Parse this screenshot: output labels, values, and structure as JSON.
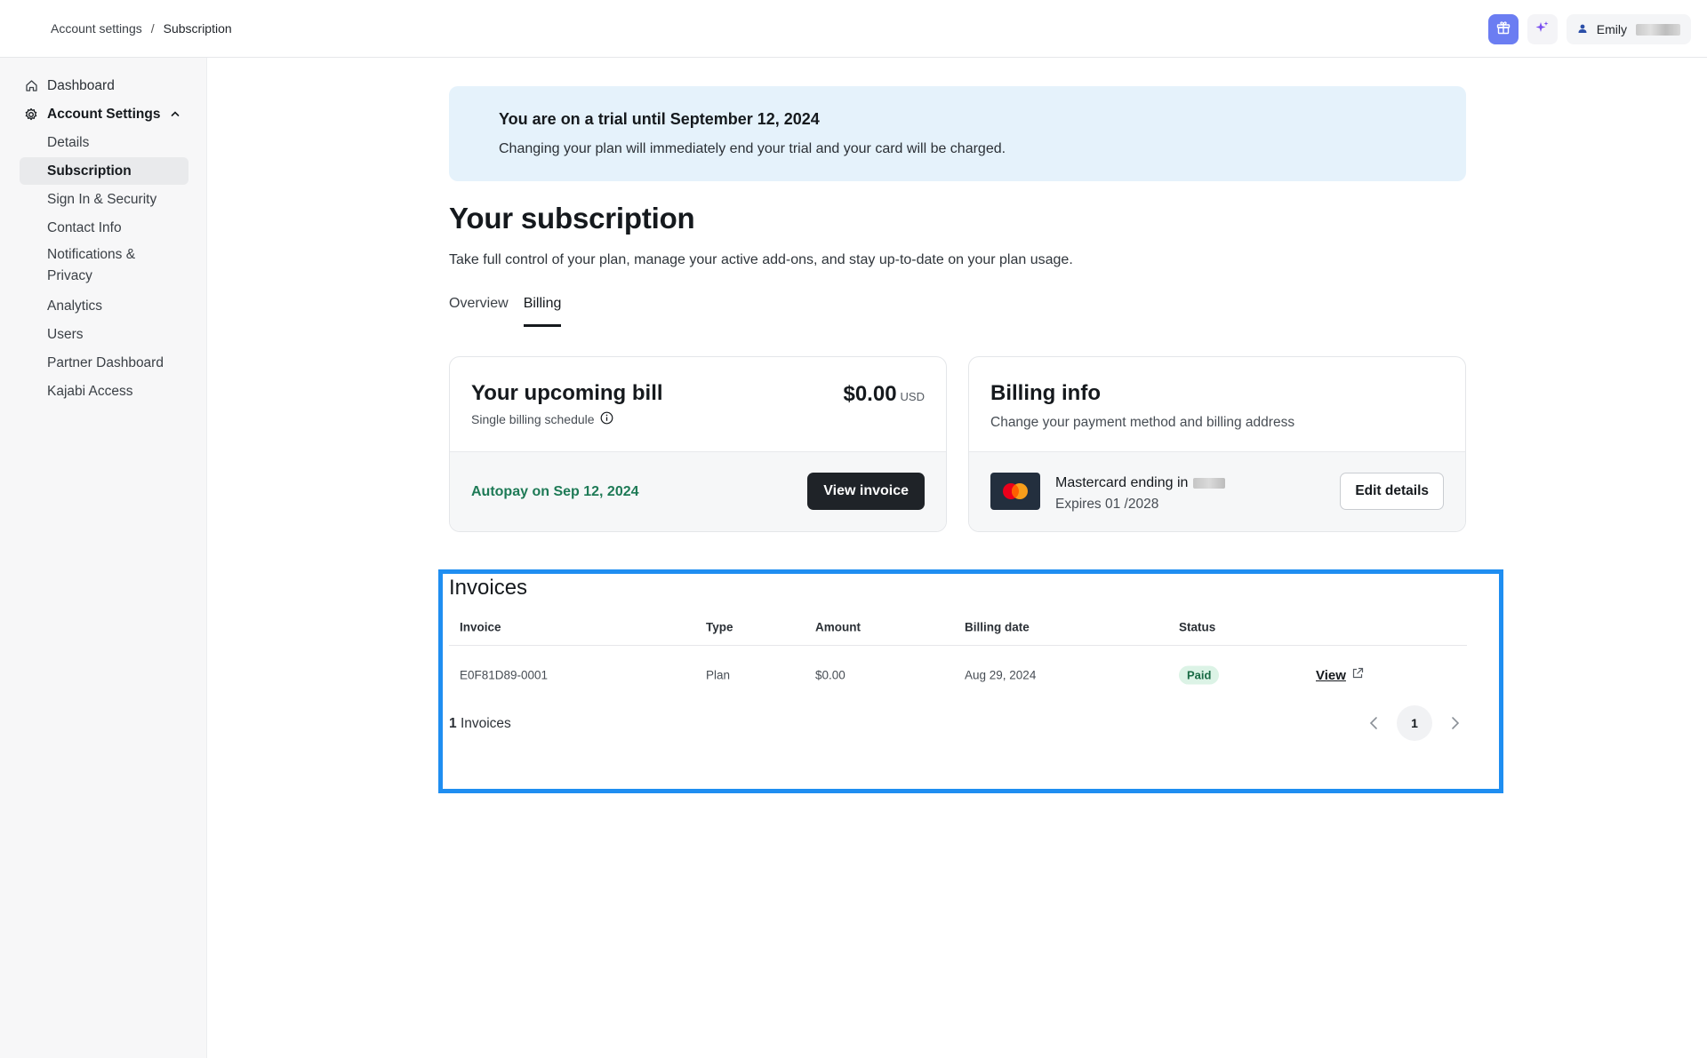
{
  "breadcrumb": {
    "parent": "Account settings",
    "separator": "/",
    "current": "Subscription"
  },
  "header": {
    "user_name": "Emily"
  },
  "sidebar": {
    "items": [
      {
        "label": "Dashboard"
      },
      {
        "label": "Account Settings"
      },
      {
        "label": "Details"
      },
      {
        "label": "Subscription"
      },
      {
        "label": "Sign In & Security"
      },
      {
        "label": "Contact Info"
      },
      {
        "label": "Notifications &",
        "label2": "Privacy"
      },
      {
        "label": "Analytics"
      },
      {
        "label": "Users"
      },
      {
        "label": "Partner Dashboard"
      },
      {
        "label": "Kajabi Access"
      }
    ]
  },
  "trial": {
    "title": "You are on a trial until September 12, 2024",
    "text": "Changing your plan will immediately end your trial and your card will be charged."
  },
  "page": {
    "title": "Your subscription",
    "description": "Take full control of your plan, manage your active add-ons, and stay up-to-date on your plan usage."
  },
  "tabs": [
    {
      "label": "Overview"
    },
    {
      "label": "Billing"
    }
  ],
  "upcoming_bill": {
    "title": "Your upcoming bill",
    "schedule": "Single billing schedule",
    "amount": "$0.00",
    "currency": "USD",
    "autopay": "Autopay on Sep 12, 2024",
    "button": "View invoice"
  },
  "billing_info": {
    "title": "Billing info",
    "subtitle": "Change your payment method and billing address",
    "card_label": "Mastercard ending in",
    "expires": "Expires 01 /2028",
    "button": "Edit details"
  },
  "invoices": {
    "title": "Invoices",
    "columns": [
      "Invoice",
      "Type",
      "Amount",
      "Billing date",
      "Status"
    ],
    "rows": [
      {
        "invoice": "E0F81D89-0001",
        "type": "Plan",
        "amount": "$0.00",
        "date": "Aug 29, 2024",
        "status": "Paid",
        "action": "View"
      }
    ],
    "count_num": "1",
    "count_label": "Invoices",
    "page": "1"
  },
  "colors": {
    "accent": "#1f8ef1",
    "banner": "#e5f2fb",
    "autopay": "#1e7a56",
    "gift": "#6b7df2"
  },
  "icons": [
    "home-icon",
    "gear-icon",
    "chevron-up-icon",
    "info-icon",
    "gift-icon",
    "sparkle-icon",
    "user-icon",
    "mastercard-icon",
    "external-link-icon",
    "chevron-left-icon",
    "chevron-right-icon"
  ]
}
